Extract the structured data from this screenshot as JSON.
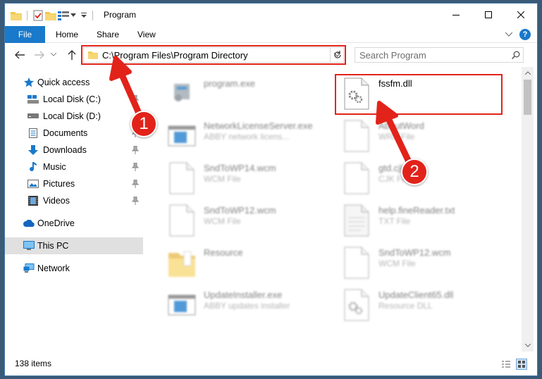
{
  "window": {
    "title": "Program"
  },
  "ribbon": {
    "file": "File",
    "tabs": [
      "Home",
      "Share",
      "View"
    ]
  },
  "address": {
    "path": "C:\\Program Files\\Program Directory"
  },
  "search": {
    "placeholder": "Search Program"
  },
  "sidebar": {
    "quick_access": "Quick access",
    "items": [
      {
        "label": "Local Disk (C:)",
        "icon": "drive-c-icon",
        "pinned": true
      },
      {
        "label": "Local Disk (D:)",
        "icon": "drive-icon",
        "pinned": false
      },
      {
        "label": "Documents",
        "icon": "documents-icon",
        "pinned": true
      },
      {
        "label": "Downloads",
        "icon": "downloads-icon",
        "pinned": true
      },
      {
        "label": "Music",
        "icon": "music-icon",
        "pinned": true
      },
      {
        "label": "Pictures",
        "icon": "pictures-icon",
        "pinned": true
      },
      {
        "label": "Videos",
        "icon": "videos-icon",
        "pinned": true
      }
    ],
    "onedrive": "OneDrive",
    "thispc": "This PC",
    "network": "Network"
  },
  "files": [
    {
      "name": "program.exe",
      "type": "",
      "icon": "exe-icon"
    },
    {
      "name": "fssfm.dll",
      "type": "",
      "icon": "dll-icon"
    },
    {
      "name": "NetworkLicenseServer.exe",
      "type": "ABBY network licens...",
      "icon": "app-window-icon"
    },
    {
      "name": "AboutWord",
      "type": "WRD File",
      "icon": "file-icon"
    },
    {
      "name": "SndToWP14.wcm",
      "type": "WCM File",
      "icon": "file-icon"
    },
    {
      "name": "gtd.cjk",
      "type": "CJK File",
      "icon": "file-icon"
    },
    {
      "name": "SndToWP12.wcm",
      "type": "WCM File",
      "icon": "file-icon"
    },
    {
      "name": "help.fineReader.txt",
      "type": "TXT File",
      "icon": "text-file-icon"
    },
    {
      "name": "Resource",
      "type": "",
      "icon": "folder-icon"
    },
    {
      "name": "SndToWP12.wcm",
      "type": "WCM File",
      "icon": "file-icon"
    },
    {
      "name": "UpdateInstaller.exe",
      "type": "ABBY updates installer",
      "icon": "app-window-icon"
    },
    {
      "name": "UpdateClient65.dll",
      "type": "Resource DLL",
      "icon": "dll-icon"
    }
  ],
  "status": {
    "items_count": "138 items"
  },
  "annotations": {
    "step1": "1",
    "step2": "2"
  },
  "colors": {
    "accent": "#1979ca",
    "highlight": "#e2231a",
    "folder": "#f2c94c"
  }
}
